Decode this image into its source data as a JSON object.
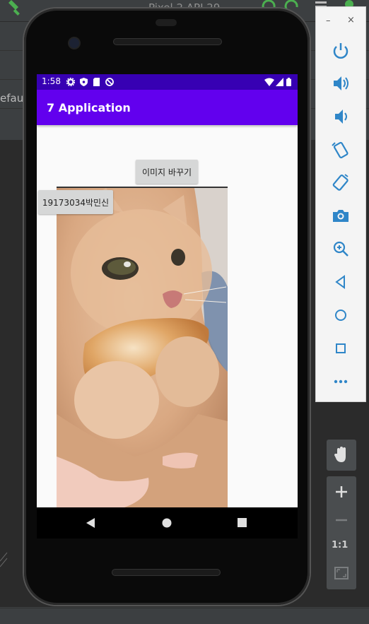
{
  "ide": {
    "device_name": "Pixel 2 API 29",
    "config_fragment": "efau"
  },
  "status_bar": {
    "time": "1:58"
  },
  "app": {
    "title": "7 Application"
  },
  "main": {
    "change_image_button": "이미지 바꾸기",
    "name_button": "19173034박민신",
    "image_icon": "cat-photo"
  },
  "emulator_panel": {
    "minimize": "–",
    "close": "×",
    "zoom_ratio": "1:1",
    "controls": [
      "power",
      "volume-up",
      "volume-down",
      "rotate-left",
      "rotate-right",
      "camera",
      "zoom",
      "back",
      "home",
      "overview",
      "more"
    ]
  },
  "colors": {
    "status_bar": "#3700b3",
    "app_bar": "#6200ee",
    "emulator_icon": "#2f86c8"
  }
}
